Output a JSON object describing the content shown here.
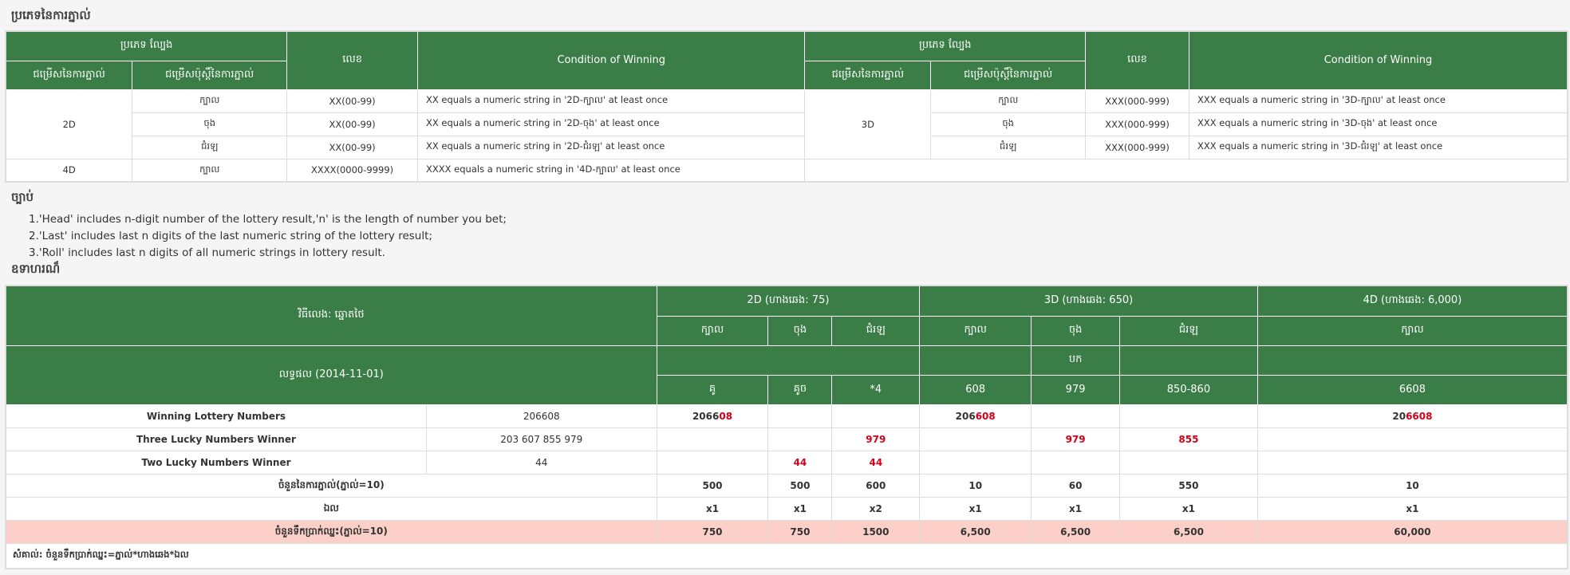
{
  "titles": {
    "bet_types": "ប្រភេទនៃការភ្នាល់",
    "explain": "ច្បាប់",
    "example": "ឧទាហរណ៏"
  },
  "table1": {
    "h_type": "ប្រភេទ ល្បែង",
    "h_option": "ជម្រើសនៃការភ្នាល់",
    "h_sub": "ជម្រើសប៉ុស្ដិ៍នៃការភ្នាល់",
    "h_number": "លេខ",
    "h_cond": "Condition of Winning",
    "left_rows": [
      {
        "cat": "2D",
        "sub": "ក្បាល",
        "num": "XX(00-99)",
        "cond": "XX equals a numeric string in '2D-ក្បាល' at least once"
      },
      {
        "sub": "ចុង",
        "num": "XX(00-99)",
        "cond": "XX equals a numeric string in '2D-ចុង' at least once"
      },
      {
        "sub": "ជំរឡ",
        "num": "XX(00-99)",
        "cond": "XX equals a numeric string in '2D-ជំរឡ' at least once"
      },
      {
        "cat": "4D",
        "sub": "ក្បាល",
        "num": "XXXX(0000-9999)",
        "cond": "XXXX equals a numeric string in '4D-ក្បាល' at least once"
      }
    ],
    "right_rows": [
      {
        "cat": "3D",
        "sub": "ក្បាល",
        "num": "XXX(000-999)",
        "cond": "XXX equals a numeric string in '3D-ក្បាល' at least once"
      },
      {
        "sub": "ចុង",
        "num": "XXX(000-999)",
        "cond": "XXX equals a numeric string in '3D-ចុង' at least once"
      },
      {
        "sub": "ជំរឡ",
        "num": "XXX(000-999)",
        "cond": "XXX equals a numeric string in '3D-ជំរឡ' at least once"
      }
    ]
  },
  "notes": [
    "1.'Head' includes n-digit number of the lottery result,'n' is the length of number you bet;",
    "2.'Last' includes last n digits of the last numeric string of the lottery result;",
    "3.'Roll' includes last n digits of all numeric strings in lottery result."
  ],
  "table2": {
    "play": "វិធីលេង: ឆ្នោតថៃ",
    "result": "លទ្ធផល (2014-11-01)",
    "g2d": "2D (ហាងឆេង: 75)",
    "g3d": "3D (ហាងឆេង: 650)",
    "g4d": "4D (ហាងឆេង: 6,000)",
    "head": "ក្បាល",
    "last": "ចុង",
    "roll": "ជំរឡ",
    "bet_label": "បក",
    "nums": [
      "គូ",
      "គូច",
      "*4",
      "608",
      "979",
      "850-860",
      "6608"
    ],
    "rows": {
      "winning": {
        "label": "Winning Lottery Numbers",
        "value": "206608",
        "c2d_black": "2066",
        "c2d_red": "08",
        "c3d_black": "206",
        "c3d_red": "608",
        "c4d_black": "20",
        "c4d_red": "6608"
      },
      "three": {
        "label": "Three Lucky Numbers Winner",
        "value": "203 607 855 979",
        "c_roll2": "979",
        "c_last3": "979",
        "c_roll3": "855"
      },
      "two": {
        "label": "Two Lucky Numbers Winner",
        "value": "44",
        "c_last2": "44",
        "c_roll2": "44"
      },
      "bets": {
        "label": "ចំនួននៃការភ្នាល់(ភ្នាល់=10)",
        "values": [
          "500",
          "500",
          "600",
          "10",
          "60",
          "550",
          "10"
        ]
      },
      "multi": {
        "label": "ឯល",
        "values": [
          "x1",
          "x1",
          "x2",
          "x1",
          "x1",
          "x1",
          "x1"
        ]
      },
      "payout": {
        "label": "ចំនួនទឹកប្រាក់ឈ្នះ(ភ្នាល់=10)",
        "values": [
          "750",
          "750",
          "1500",
          "6,500",
          "6,500",
          "6,500",
          "60,000"
        ]
      }
    },
    "note": "សំគាល់: ចំនួនទឹកប្រាក់ឈ្នះ=ភ្នាល់*ហាងឆេង*ឯល"
  }
}
